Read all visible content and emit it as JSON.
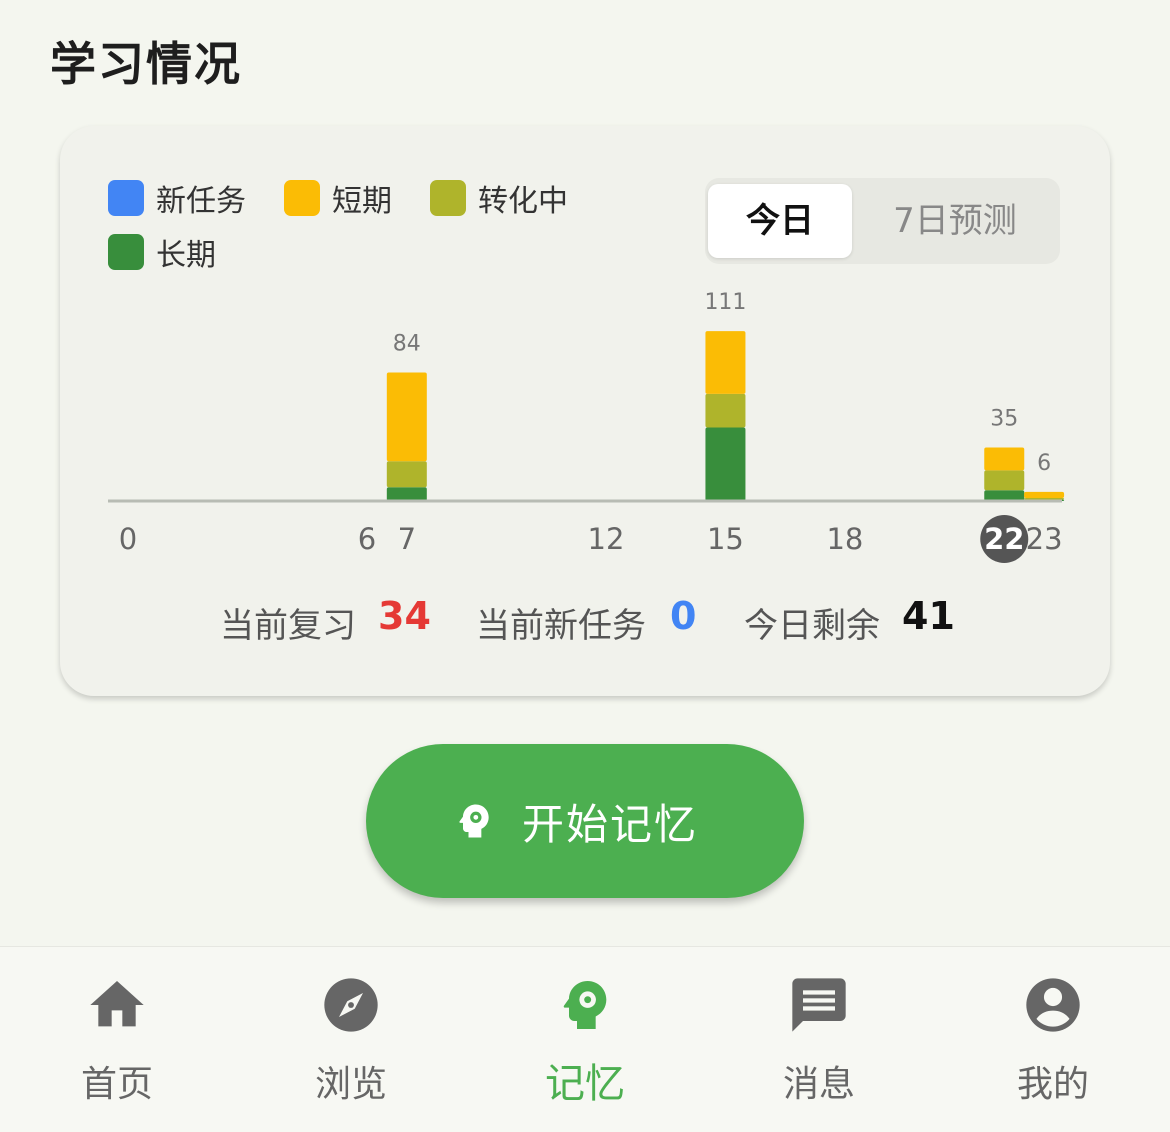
{
  "page": {
    "title": "学习情况"
  },
  "legend": [
    {
      "label": "新任务",
      "color": "#4285f4"
    },
    {
      "label": "短期",
      "color": "#fbbc05"
    },
    {
      "label": "转化中",
      "color": "#afb42b"
    },
    {
      "label": "长期",
      "color": "#388e3c"
    }
  ],
  "toggle": {
    "today": "今日",
    "forecast": "7日预测",
    "selected": "今日"
  },
  "chart_data": {
    "type": "bar",
    "stacked": true,
    "x_ticks": [
      "0",
      "6",
      "7",
      "12",
      "15",
      "18",
      "22",
      "23"
    ],
    "current_hour": "22",
    "categories": [
      "7",
      "15",
      "22",
      "23"
    ],
    "series": [
      {
        "name": "长期",
        "color": "#388e3c",
        "values": [
          9,
          48,
          7,
          1
        ]
      },
      {
        "name": "转化中",
        "color": "#afb42b",
        "values": [
          17,
          22,
          13,
          1
        ]
      },
      {
        "name": "短期",
        "color": "#fbbc05",
        "values": [
          58,
          41,
          15,
          4
        ]
      },
      {
        "name": "新任务",
        "color": "#4285f4",
        "values": [
          0,
          0,
          0,
          0
        ]
      }
    ],
    "totals": [
      84,
      111,
      35,
      6
    ],
    "xlim": [
      0,
      23
    ],
    "ylim": [
      0,
      111
    ]
  },
  "stats": {
    "review_label": "当前复习",
    "review_value": "34",
    "review_color": "#e53935",
    "new_label": "当前新任务",
    "new_value": "0",
    "new_color": "#4285f4",
    "remaining_label": "今日剩余",
    "remaining_value": "41",
    "remaining_color": "#111111"
  },
  "start_button": {
    "label": "开始记忆",
    "icon": "brain-gear-icon"
  },
  "bottom_nav": [
    {
      "label": "首页",
      "icon": "home-icon",
      "active": false
    },
    {
      "label": "浏览",
      "icon": "compass-icon",
      "active": false
    },
    {
      "label": "记忆",
      "icon": "brain-gear-icon",
      "active": true
    },
    {
      "label": "消息",
      "icon": "message-icon",
      "active": false
    },
    {
      "label": "我的",
      "icon": "account-icon",
      "active": false
    }
  ]
}
